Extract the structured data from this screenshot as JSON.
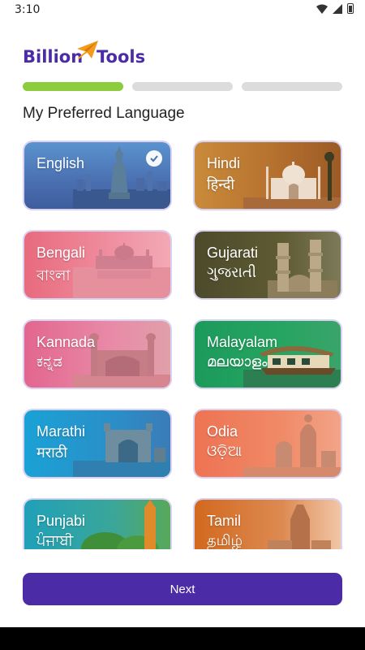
{
  "status_bar": {
    "time": "3:10"
  },
  "logo": {
    "part1": "Billion",
    "part2": "Tools"
  },
  "progress": {
    "steps": 3,
    "current_step": 1
  },
  "title": "My Preferred Language",
  "languages": [
    {
      "name": "English",
      "native": "",
      "selected": true
    },
    {
      "name": "Hindi",
      "native": "हिन्दी",
      "selected": false
    },
    {
      "name": "Bengali",
      "native": "বাংলা",
      "selected": false
    },
    {
      "name": "Gujarati",
      "native": "ગુજરાતી",
      "selected": false
    },
    {
      "name": "Kannada",
      "native": "ಕನ್ನಡ",
      "selected": false
    },
    {
      "name": "Malayalam",
      "native": "മലയാളം",
      "selected": false
    },
    {
      "name": "Marathi",
      "native": "मराठी",
      "selected": false
    },
    {
      "name": "Odia",
      "native": "ଓଡ଼ିଆ",
      "selected": false
    },
    {
      "name": "Punjabi",
      "native": "ਪੰਜਾਬੀ",
      "selected": false
    },
    {
      "name": "Tamil",
      "native": "தமிழ்",
      "selected": false
    }
  ],
  "next_button": {
    "label": "Next"
  },
  "colors": {
    "brand": "#4b2ba6",
    "accent_orange": "#f59a1b",
    "progress_active": "#8dcc3c"
  }
}
